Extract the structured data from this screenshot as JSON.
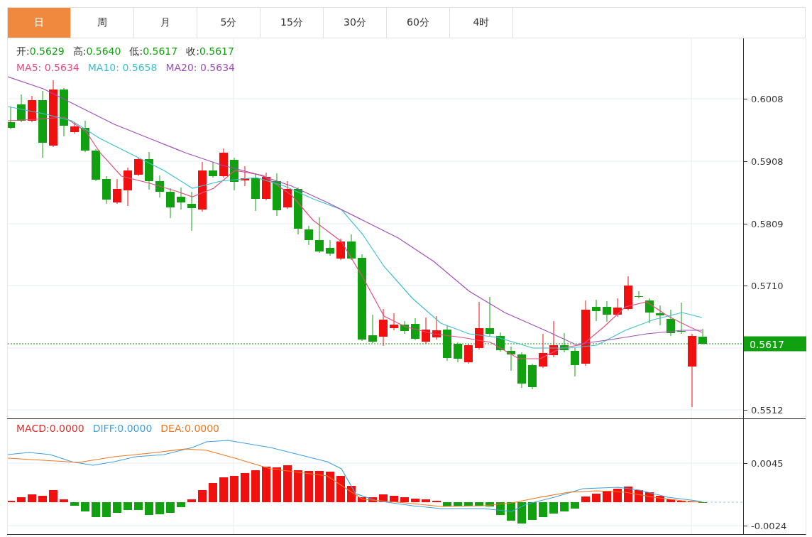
{
  "tabs": [
    {
      "label": "日",
      "selected": true
    },
    {
      "label": "周",
      "selected": false
    },
    {
      "label": "月",
      "selected": false
    },
    {
      "label": "5分",
      "selected": false
    },
    {
      "label": "15分",
      "selected": false
    },
    {
      "label": "30分",
      "selected": false
    },
    {
      "label": "60分",
      "selected": false
    },
    {
      "label": "4时",
      "selected": false
    }
  ],
  "price_legend": [
    {
      "label": "开:",
      "value": "0.5629"
    },
    {
      "label": "高:",
      "value": "0.5640"
    },
    {
      "label": "低:",
      "value": "0.5617"
    },
    {
      "label": "收:",
      "value": "0.5617"
    }
  ],
  "ma_legend": [
    {
      "label": "MA5:",
      "value": "0.5634",
      "color": "#e0507e"
    },
    {
      "label": "MA10:",
      "value": "0.5658",
      "color": "#3cc0d0"
    },
    {
      "label": "MA20:",
      "value": "0.5634",
      "color": "#a050b8"
    }
  ],
  "price_axis": [
    "0.6008",
    "0.5908",
    "0.5809",
    "0.5710",
    "0.5512"
  ],
  "current_price": "0.5617",
  "macd_legend": [
    {
      "label": "MACD:",
      "value": "0.0000",
      "color": "#e03030"
    },
    {
      "label": "DIFF:",
      "value": "0.0000",
      "color": "#40a0e0"
    },
    {
      "label": "DEA:",
      "value": "0.0000",
      "color": "#f07820"
    }
  ],
  "macd_axis": [
    "0.0045",
    "-0.0024"
  ]
}
